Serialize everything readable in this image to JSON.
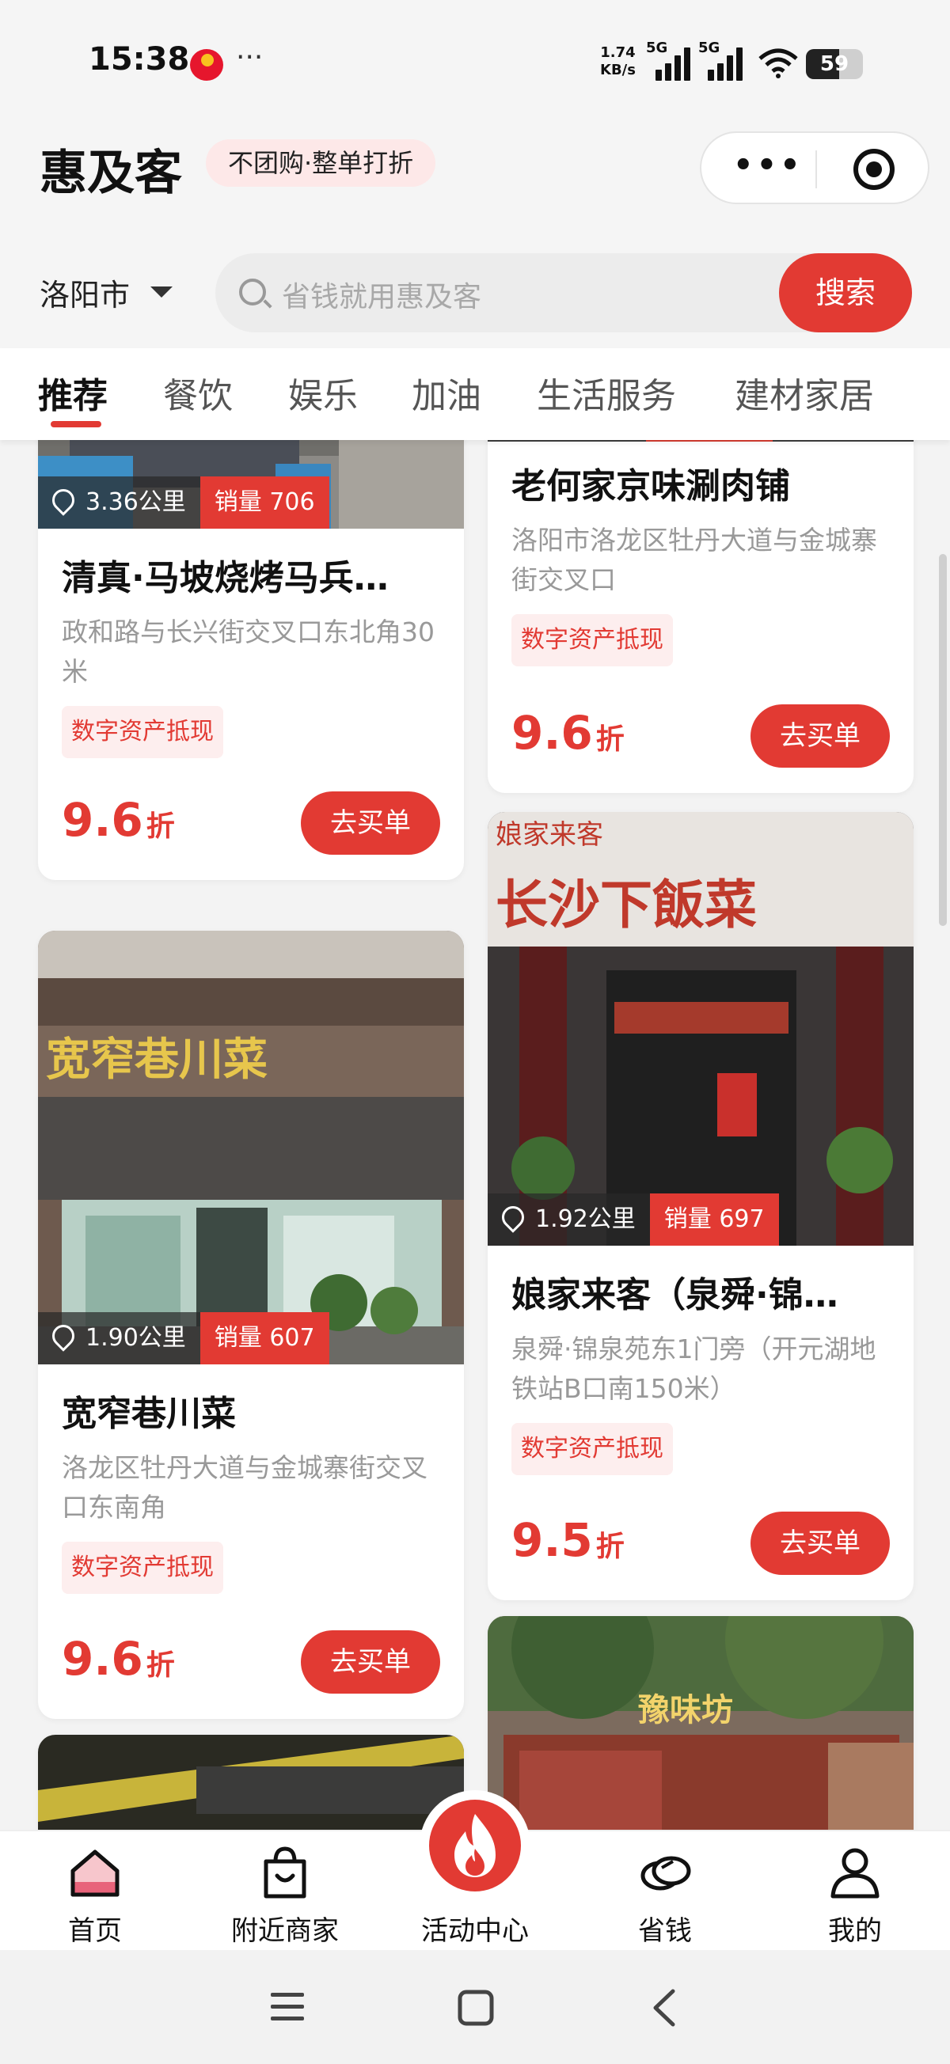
{
  "status_bar": {
    "time": "15:38",
    "net_speed_value": "1.74",
    "net_speed_unit": "KB/s",
    "signal_tags": [
      "5G",
      "5G"
    ],
    "battery": "59",
    "battery_level": 0.59
  },
  "header": {
    "title": "惠及客",
    "slogan": "不团购·整单打折"
  },
  "search": {
    "city": "洛阳市",
    "placeholder": "省钱就用惠及客",
    "button_label": "搜索"
  },
  "tabs": [
    {
      "label": "推荐",
      "active": true
    },
    {
      "label": "餐饮"
    },
    {
      "label": "娱乐"
    },
    {
      "label": "加油"
    },
    {
      "label": "生活服务"
    },
    {
      "label": "建材家居"
    }
  ],
  "cards": [
    {
      "name": "清真·马坡烧烤马兵…",
      "distance": "3.36公里",
      "sales": "销量 706",
      "address": "政和路与长兴街交叉口东北角30米",
      "tag": "数字资产抵现",
      "discount": "9.6",
      "discount_unit": "折",
      "button": "去买单"
    },
    {
      "name": "老何家京味涮肉铺",
      "address": "洛阳市洛龙区牡丹大道与金城寨街交叉口",
      "tag": "数字资产抵现",
      "discount": "9.6",
      "discount_unit": "折",
      "button": "去买单"
    },
    {
      "name": "宽窄巷川菜",
      "distance": "1.90公里",
      "sales": "销量 607",
      "address": "洛龙区牡丹大道与金城寨街交叉口东南角",
      "tag": "数字资产抵现",
      "discount": "9.6",
      "discount_unit": "折",
      "button": "去买单",
      "sign_text": "宽窄巷川菜"
    },
    {
      "name": "娘家来客（泉舜·锦…",
      "distance": "1.92公里",
      "sales": "销量 697",
      "address": "泉舜·锦泉苑东1门旁（开元湖地铁站B口南150米）",
      "tag": "数字资产抵现",
      "discount": "9.5",
      "discount_unit": "折",
      "button": "去买单",
      "sign_small": "娘家来客",
      "sign_text": "长沙下飯菜"
    },
    {
      "sign_text": "豫味坊"
    }
  ],
  "bottom_nav": [
    {
      "label": "首页",
      "icon": "home-icon"
    },
    {
      "label": "附近商家",
      "icon": "shopping-bag-icon"
    },
    {
      "label": "活动中心",
      "icon": "flame-icon"
    },
    {
      "label": "省钱",
      "icon": "coins-icon"
    },
    {
      "label": "我的",
      "icon": "user-icon"
    }
  ],
  "colors": {
    "brand_red": "#e23a33",
    "tag_bg": "#fdeeee",
    "page_bg": "#f3f3f3"
  }
}
